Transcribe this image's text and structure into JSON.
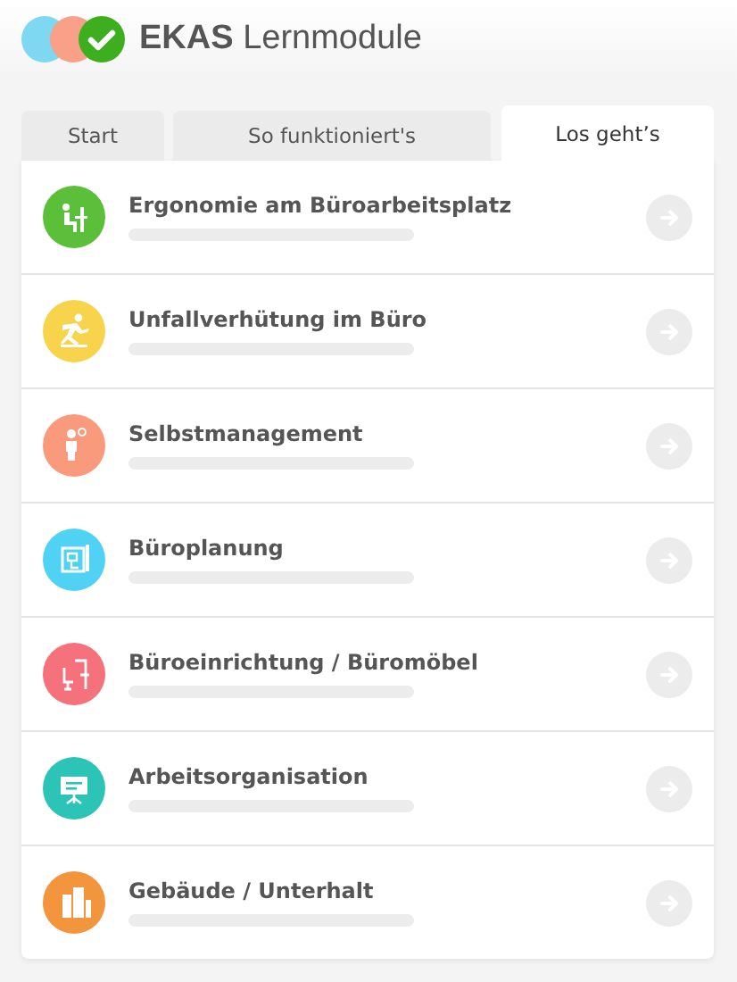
{
  "header": {
    "title_bold": "EKAS",
    "title_rest": "Lernmodule"
  },
  "tabs": [
    {
      "label": "Start",
      "selected": false
    },
    {
      "label": "So funktioniert's",
      "selected": false
    },
    {
      "label": "Los geht’s",
      "selected": true
    }
  ],
  "modules": [
    {
      "title": "Ergonomie am Büroarbeitsplatz",
      "color": "#5cbf3a"
    },
    {
      "title": "Unfallverhütung im Büro",
      "color": "#f7d44c"
    },
    {
      "title": "Selbstmanagement",
      "color": "#fa9a7c"
    },
    {
      "title": "Büroplanung",
      "color": "#4fd2f4"
    },
    {
      "title": "Büroeinrichtung / Büromöbel",
      "color": "#f5727c"
    },
    {
      "title": "Arbeitsorganisation",
      "color": "#2cc4b6"
    },
    {
      "title": "Gebäude / Unterhalt",
      "color": "#f3953c"
    }
  ]
}
